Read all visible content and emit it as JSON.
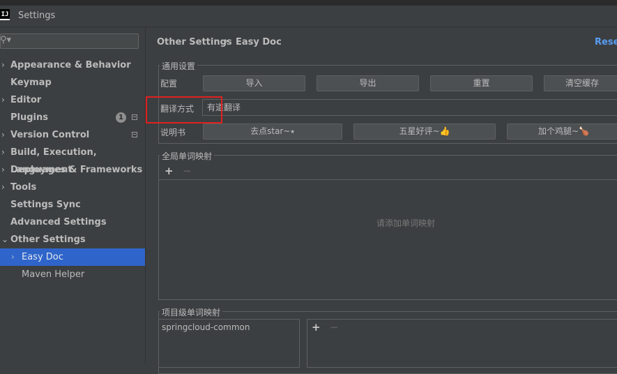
{
  "window": {
    "title": "Settings",
    "app_icon": "IJ"
  },
  "search": {
    "placeholder": "",
    "icon": "search-icon"
  },
  "sidebar": {
    "items": [
      {
        "label": "Appearance & Behavior",
        "chevron": "›",
        "level": 0
      },
      {
        "label": "Keymap",
        "level": 0
      },
      {
        "label": "Editor",
        "chevron": "›",
        "level": 0
      },
      {
        "label": "Plugins",
        "level": 0,
        "badge": "1"
      },
      {
        "label": "Version Control",
        "chevron": "›",
        "level": 0
      },
      {
        "label": "Build, Execution, Deployment",
        "chevron": "›",
        "level": 0
      },
      {
        "label": "Languages & Frameworks",
        "chevron": "›",
        "level": 0
      },
      {
        "label": "Tools",
        "chevron": "›",
        "level": 0
      },
      {
        "label": "Settings Sync",
        "level": 0
      },
      {
        "label": "Advanced Settings",
        "level": 0
      },
      {
        "label": "Other Settings",
        "chevron": "⌄",
        "level": 0
      },
      {
        "label": "Easy Doc",
        "chevron": "›",
        "level": 1,
        "selected": true
      },
      {
        "label": "Maven Helper",
        "level": 1
      }
    ]
  },
  "breadcrumb": {
    "parent": "Other Settings",
    "separator": "›",
    "current": "Easy Doc"
  },
  "reset_label": "Reset",
  "general": {
    "title": "通用设置",
    "config_label": "配置",
    "buttons": {
      "import": "导入",
      "export": "导出",
      "reset": "重置",
      "clear_cache": "清空缓存"
    },
    "translate_label": "翻译方式",
    "translate_value": "有道翻译",
    "manual_label": "说明书",
    "manual_buttons": {
      "star": "去点star~⭑",
      "rate": "五星好评~👍",
      "drumstick": "加个鸡腿~🍗"
    }
  },
  "global_mapping": {
    "title": "全局单词映射",
    "add": "+",
    "remove": "−",
    "empty_text": "请添加单词映射"
  },
  "project_mapping": {
    "title": "项目级单词映射",
    "project": "springcloud-common",
    "add": "+",
    "remove": "−"
  },
  "colors": {
    "accent": "#589df6",
    "selection": "#2f65ca",
    "highlight": "#e02020",
    "background": "#3c3f41"
  }
}
